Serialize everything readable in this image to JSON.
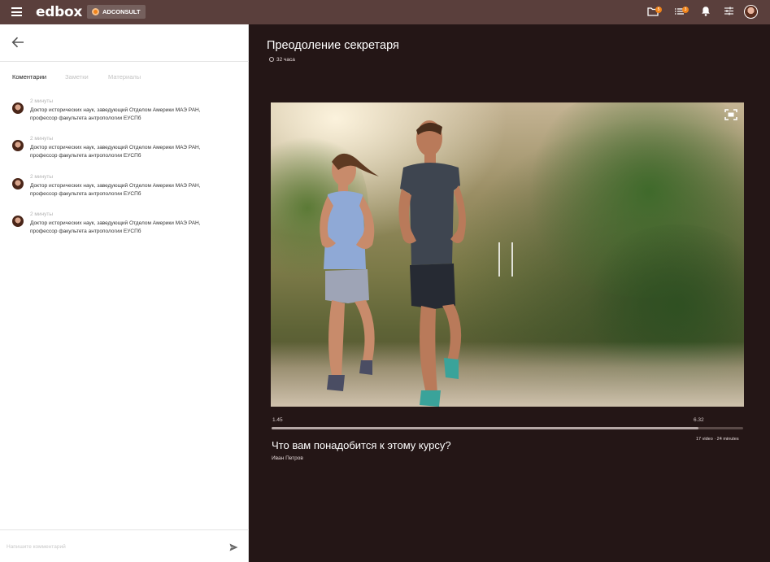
{
  "header": {
    "logo": "edbox",
    "partner": "ADCONSULT",
    "badges": {
      "folder": "5",
      "list": "3"
    },
    "icons": [
      "menu-icon",
      "folder-icon",
      "list-icon",
      "bell-icon",
      "settings-sliders-icon",
      "avatar"
    ]
  },
  "sidebar": {
    "tabs": [
      {
        "label": "Коментарии",
        "active": true
      },
      {
        "label": "Заметки",
        "active": false
      },
      {
        "label": "Материалы",
        "active": false
      }
    ],
    "comments": [
      {
        "time": "2 минуты",
        "text": "Доктор исторических наук, заведующий Отделом Америки МАЭ РАН, профессор факультета антропологии ЕУСПб"
      },
      {
        "time": "2 минуты",
        "text": "Доктор исторических наук, заведующий Отделом Америки МАЭ РАН, профессор факультета антропологии ЕУСПб"
      },
      {
        "time": "2 минуты",
        "text": "Доктор исторических наук, заведующий Отделом Америки МАЭ РАН, профессор факультета антропологии ЕУСПб"
      },
      {
        "time": "2 минуты",
        "text": "Доктор исторических наук, заведующий Отделом Америки МАЭ РАН, профессор факультета антропологии ЕУСПб"
      }
    ],
    "compose": {
      "placeholder": "Напишите комментарий",
      "value": ""
    }
  },
  "course": {
    "title": "Преодоление секретаря",
    "duration": "32 часа"
  },
  "player": {
    "current_time": "1.45",
    "total_time": "6.32",
    "progress": 0.906,
    "state": "playing"
  },
  "lesson": {
    "title": "Что вам понадобится к этому курсу?",
    "author": "Иван Петров",
    "meta": "17 video · 24 minutes"
  },
  "colors": {
    "topbar": "#5a3f3c",
    "background": "#241616",
    "accent": "#f0831a"
  }
}
